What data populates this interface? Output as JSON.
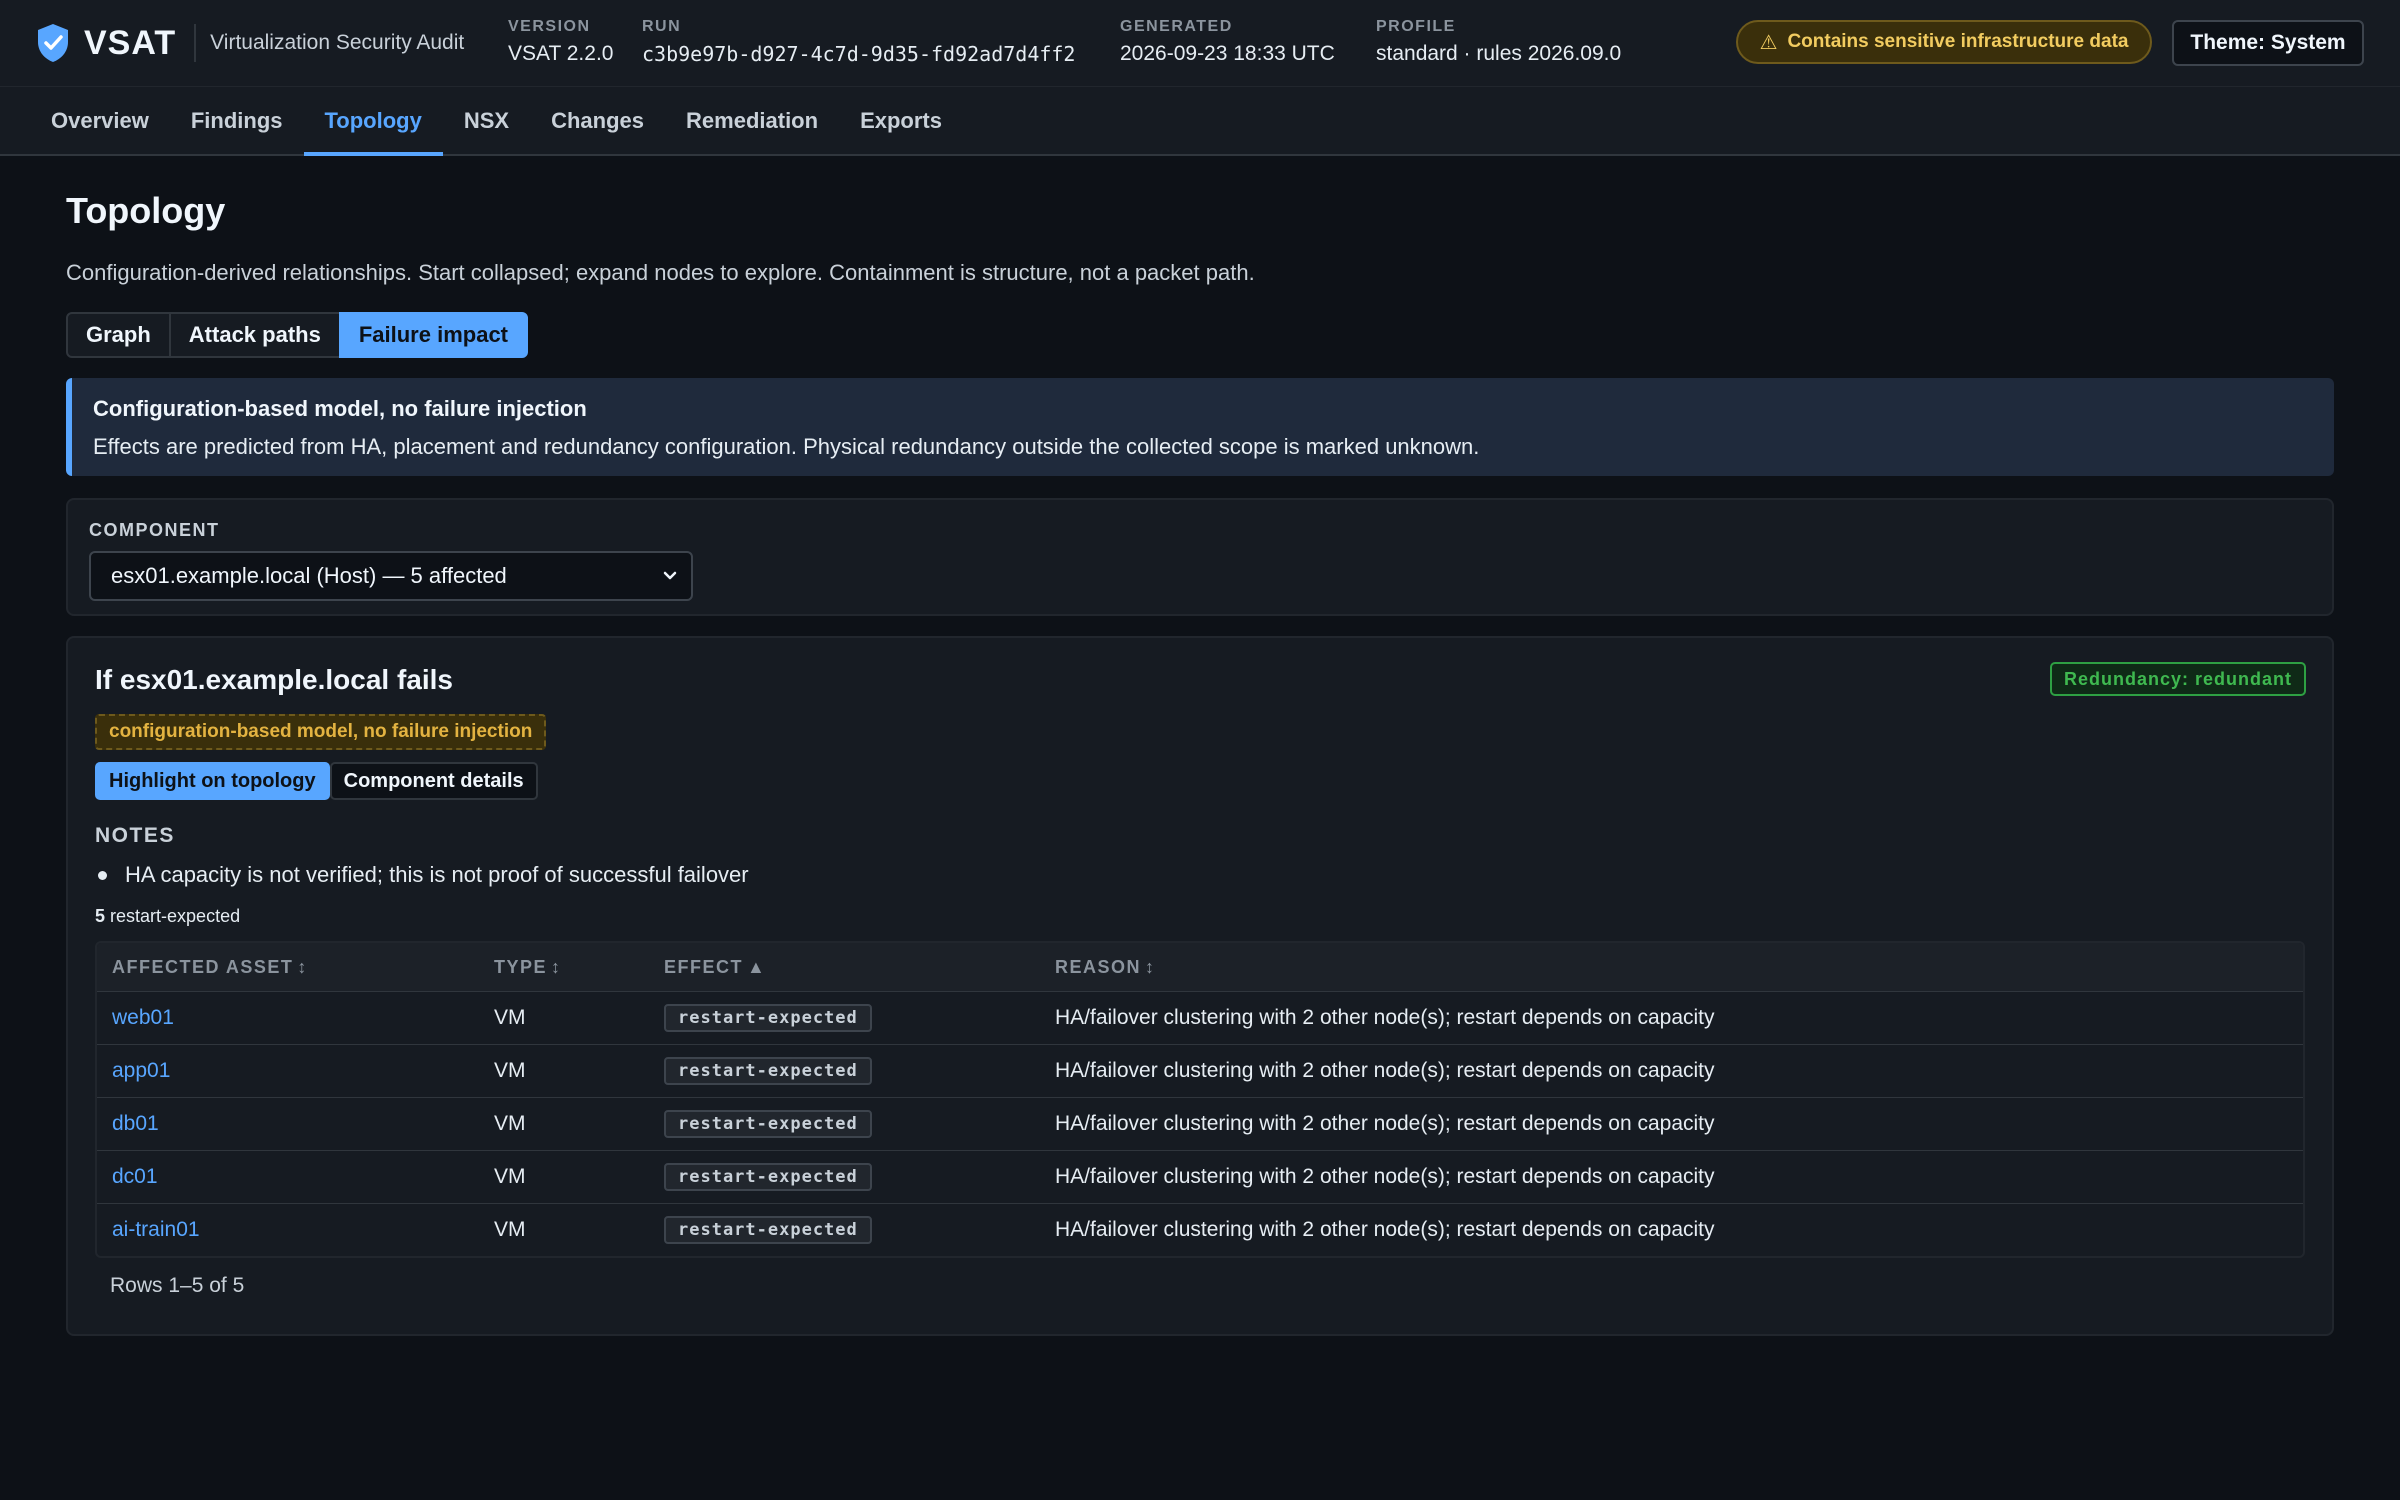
{
  "header": {
    "brand": "VSAT",
    "subtitle": "Virtualization Security Audit",
    "version_label": "VERSION",
    "version_value": "VSAT 2.2.0",
    "run_label": "RUN",
    "run_value": "c3b9e97b-d927-4c7d-9d35-fd92ad7d4ff2",
    "generated_label": "GENERATED",
    "generated_value": "2026-09-23 18:33 UTC",
    "profile_label": "PROFILE",
    "profile_value": "standard · rules 2026.09.0",
    "warning": "Contains sensitive infrastructure data",
    "theme_button": "Theme: System"
  },
  "nav": {
    "tabs": [
      {
        "label": "Overview"
      },
      {
        "label": "Findings"
      },
      {
        "label": "Topology"
      },
      {
        "label": "NSX"
      },
      {
        "label": "Changes"
      },
      {
        "label": "Remediation"
      },
      {
        "label": "Exports"
      }
    ],
    "active": "Topology"
  },
  "page": {
    "title": "Topology",
    "description": "Configuration-derived relationships. Start collapsed; expand nodes to explore. Containment is structure, not a packet path.",
    "views": [
      {
        "label": "Graph"
      },
      {
        "label": "Attack paths"
      },
      {
        "label": "Failure impact"
      }
    ],
    "active_view": "Failure impact"
  },
  "info": {
    "title": "Configuration-based model, no failure injection",
    "text": "Effects are predicted from HA, placement and redundancy configuration. Physical redundancy outside the collected scope is marked unknown."
  },
  "component": {
    "label": "COMPONENT",
    "selected": "esx01.example.local (Host) — 5 affected"
  },
  "result": {
    "title": "If esx01.example.local fails",
    "redundancy_badge": "Redundancy: redundant",
    "model_badge": "configuration-based model, no failure injection",
    "highlight_button": "Highlight on topology",
    "details_button": "Component details",
    "notes_label": "NOTES",
    "notes": [
      "HA capacity is not verified; this is not proof of successful failover"
    ],
    "count": "5",
    "count_text": "restart-expected"
  },
  "table": {
    "columns": [
      {
        "label": "AFFECTED ASSET",
        "sort": "↕"
      },
      {
        "label": "TYPE",
        "sort": "↕"
      },
      {
        "label": "EFFECT",
        "sort": "▲"
      },
      {
        "label": "REASON",
        "sort": "↕"
      }
    ],
    "rows": [
      {
        "asset": "web01",
        "type": "VM",
        "effect": "restart-expected",
        "reason": "HA/failover clustering with 2 other node(s); restart depends on capacity"
      },
      {
        "asset": "app01",
        "type": "VM",
        "effect": "restart-expected",
        "reason": "HA/failover clustering with 2 other node(s); restart depends on capacity"
      },
      {
        "asset": "db01",
        "type": "VM",
        "effect": "restart-expected",
        "reason": "HA/failover clustering with 2 other node(s); restart depends on capacity"
      },
      {
        "asset": "dc01",
        "type": "VM",
        "effect": "restart-expected",
        "reason": "HA/failover clustering with 2 other node(s); restart depends on capacity"
      },
      {
        "asset": "ai-train01",
        "type": "VM",
        "effect": "restart-expected",
        "reason": "HA/failover clustering with 2 other node(s); restart depends on capacity"
      }
    ],
    "footer": "Rows 1–5 of 5"
  },
  "colors": {
    "background": "#0d1117",
    "accent": "#58a6ff",
    "warning": "#f2cc60",
    "success": "#3fb950"
  },
  "icons": {
    "brand": "shield-check-icon",
    "warning": "warning-triangle-icon",
    "select": "chevron-down-icon"
  }
}
